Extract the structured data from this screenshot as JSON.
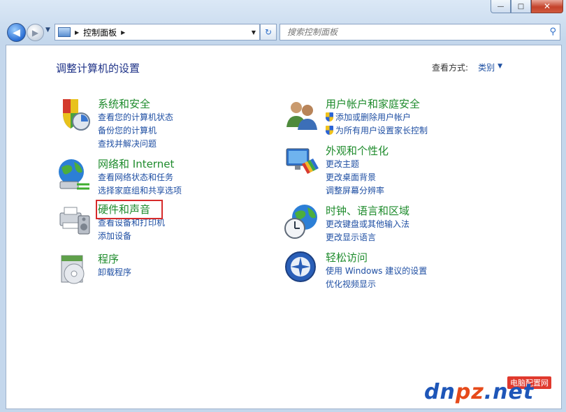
{
  "window": {
    "minimize_label": "—",
    "maximize_label": "□",
    "close_label": "✕"
  },
  "nav": {
    "back_glyph": "◀",
    "forward_glyph": "▶",
    "recent_glyph": "▼",
    "address_sep1": "▶",
    "address_text": "控制面板",
    "address_sep2": "▶",
    "dropdown_glyph": "▼",
    "refresh_glyph": "↻",
    "search_placeholder": "搜索控制面板",
    "search_glyph": "⚲"
  },
  "main": {
    "heading": "调整计算机的设置",
    "view_by_label": "查看方式:",
    "view_by_value": "类别",
    "view_by_arrow": "▼"
  },
  "categories": [
    {
      "title": "系统和安全",
      "icon": "system-security-icon",
      "links": [
        "查看您的计算机状态",
        "备份您的计算机",
        "查找并解决问题"
      ]
    },
    {
      "title": "网络和 Internet",
      "icon": "network-internet-icon",
      "links": [
        "查看网络状态和任务",
        "选择家庭组和共享选项"
      ]
    },
    {
      "title": "硬件和声音",
      "icon": "hardware-sound-icon",
      "links": [
        "查看设备和打印机",
        "添加设备"
      ]
    },
    {
      "title": "程序",
      "icon": "programs-icon",
      "links": [
        "卸载程序"
      ]
    },
    {
      "title": "用户帐户和家庭安全",
      "icon": "user-accounts-icon",
      "links": [
        "添加或删除用户帐户",
        "为所有用户设置家长控制"
      ]
    },
    {
      "title": "外观和个性化",
      "icon": "appearance-icon",
      "links": [
        "更改主题",
        "更改桌面背景",
        "调整屏幕分辨率"
      ]
    },
    {
      "title": "时钟、语言和区域",
      "icon": "clock-language-region-icon",
      "links": [
        "更改键盘或其他输入法",
        "更改显示语言"
      ]
    },
    {
      "title": "轻松访问",
      "icon": "ease-of-access-icon",
      "links": [
        "使用 Windows 建议的设置",
        "优化视频显示"
      ]
    }
  ],
  "watermark": {
    "badge": "电脑配置网",
    "logo_a": "dn",
    "logo_b": "pz",
    "logo_c": ".net"
  },
  "colors": {
    "category_title": "#1e8b2c",
    "link": "#1f4fa3",
    "heading": "#1e3287",
    "highlight_border": "#d62b2b"
  }
}
